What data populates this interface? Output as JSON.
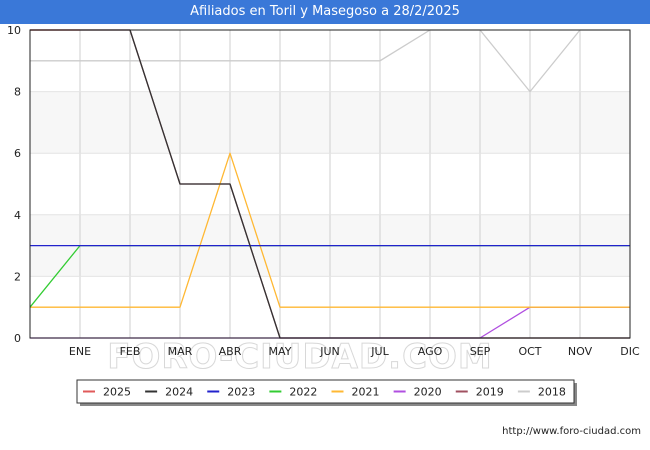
{
  "header": {
    "title": "Afiliados en Toril y Masegoso a 28/2/2025"
  },
  "footer": {
    "source": "http://www.foro-ciudad.com"
  },
  "watermark": "FORO-CIUDAD.COM",
  "chart_data": {
    "type": "line",
    "title": "Afiliados en Toril y Masegoso a 28/2/2025",
    "xlabel": "",
    "ylabel": "",
    "categories": [
      "ENE",
      "FEB",
      "MAR",
      "ABR",
      "MAY",
      "JUN",
      "JUL",
      "AGO",
      "SEP",
      "OCT",
      "NOV",
      "DIC"
    ],
    "yticks": [
      "0",
      "2",
      "4",
      "6",
      "8",
      "10"
    ],
    "ylim": [
      0,
      10
    ],
    "grid": true,
    "legend_position": "bottom",
    "series": [
      {
        "name": "2025",
        "color": "#e05a5a",
        "x": [
          0,
          1
        ],
        "values": [
          10,
          10
        ]
      },
      {
        "name": "2024",
        "color": "#333333",
        "x": [
          0,
          1,
          2,
          3,
          4,
          5,
          6,
          7,
          8,
          9,
          10,
          11,
          12
        ],
        "values": [
          10,
          10,
          10,
          5,
          5,
          0,
          0,
          0,
          0,
          0,
          0,
          0,
          0
        ]
      },
      {
        "name": "2023",
        "color": "#2222cc",
        "x": [
          0,
          1,
          2,
          3,
          4,
          5,
          6,
          7,
          8,
          9,
          10,
          11,
          12
        ],
        "values": [
          3,
          3,
          3,
          3,
          3,
          3,
          3,
          3,
          3,
          3,
          3,
          3,
          3
        ]
      },
      {
        "name": "2022",
        "color": "#33cc33",
        "x": [
          0,
          1,
          2,
          3,
          4,
          5,
          6,
          7,
          8,
          9,
          10,
          11,
          12
        ],
        "values": [
          1,
          3,
          3,
          3,
          3,
          3,
          3,
          3,
          3,
          3,
          3,
          3,
          3
        ]
      },
      {
        "name": "2021",
        "color": "#ffb833",
        "x": [
          0,
          1,
          2,
          3,
          4,
          5,
          6,
          7,
          8,
          9,
          10,
          11,
          12
        ],
        "values": [
          1,
          1,
          1,
          1,
          6,
          1,
          1,
          1,
          1,
          1,
          1,
          1,
          1
        ]
      },
      {
        "name": "2020",
        "color": "#b04fe0",
        "x": [
          0,
          1,
          2,
          3,
          4,
          5,
          6,
          7,
          8,
          9,
          10,
          11,
          12
        ],
        "values": [
          0,
          0,
          0,
          0,
          0,
          0,
          0,
          0,
          0,
          0,
          1,
          1,
          1
        ]
      },
      {
        "name": "2019",
        "color": "#a05060",
        "x": [
          0,
          1,
          2,
          3,
          4,
          5,
          6,
          7,
          8,
          9,
          10,
          11,
          12
        ],
        "values": [
          10,
          10,
          10,
          5,
          5,
          0,
          0,
          0,
          0,
          0,
          0,
          0,
          0
        ]
      },
      {
        "name": "2018",
        "color": "#cccccc",
        "x": [
          0,
          1,
          2,
          3,
          4,
          5,
          6,
          7,
          8,
          9,
          10,
          11,
          12
        ],
        "values": [
          9,
          9,
          9,
          9,
          9,
          9,
          9,
          9,
          10,
          10,
          8,
          10,
          10
        ]
      }
    ]
  }
}
